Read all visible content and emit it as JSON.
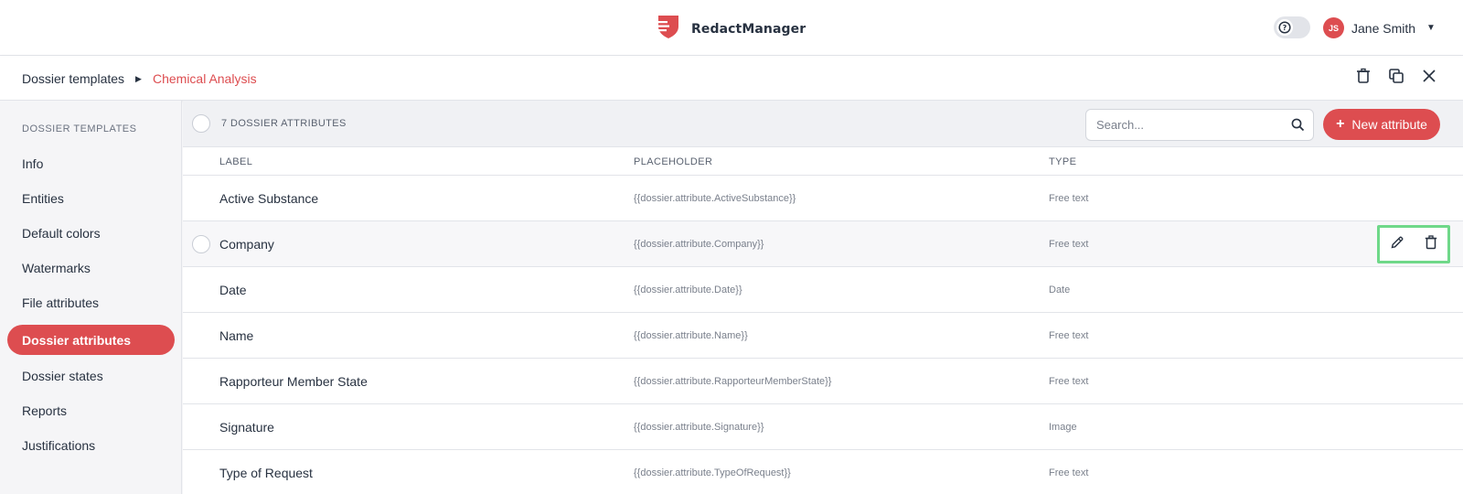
{
  "app": {
    "name": "RedactManager"
  },
  "user": {
    "initials": "JS",
    "name": "Jane Smith"
  },
  "breadcrumb": {
    "root": "Dossier templates",
    "current": "Chemical Analysis"
  },
  "sidebar": {
    "title": "DOSSIER TEMPLATES",
    "items": [
      {
        "label": "Info"
      },
      {
        "label": "Entities"
      },
      {
        "label": "Default colors"
      },
      {
        "label": "Watermarks"
      },
      {
        "label": "File attributes"
      },
      {
        "label": "Dossier attributes",
        "active": true
      },
      {
        "label": "Dossier states"
      },
      {
        "label": "Reports"
      },
      {
        "label": "Justifications"
      }
    ]
  },
  "table": {
    "count_label": "7 DOSSIER ATTRIBUTES",
    "search_placeholder": "Search...",
    "new_button_label": "New attribute",
    "columns": {
      "label": "LABEL",
      "placeholder": "PLACEHOLDER",
      "type": "TYPE"
    },
    "rows": [
      {
        "label": "Active Substance",
        "placeholder": "{{dossier.attribute.ActiveSubstance}}",
        "type": "Free text"
      },
      {
        "label": "Company",
        "placeholder": "{{dossier.attribute.Company}}",
        "type": "Free text"
      },
      {
        "label": "Date",
        "placeholder": "{{dossier.attribute.Date}}",
        "type": "Date"
      },
      {
        "label": "Name",
        "placeholder": "{{dossier.attribute.Name}}",
        "type": "Free text"
      },
      {
        "label": "Rapporteur Member State",
        "placeholder": "{{dossier.attribute.RapporteurMemberState}}",
        "type": "Free text"
      },
      {
        "label": "Signature",
        "placeholder": "{{dossier.attribute.Signature}}",
        "type": "Image"
      },
      {
        "label": "Type of Request",
        "placeholder": "{{dossier.attribute.TypeOfRequest}}",
        "type": "Free text"
      }
    ]
  },
  "icons": {
    "logo": "redact-shield-icon",
    "help": "help-icon",
    "caret": "caret-down-icon",
    "breadcrumb_sep": "caret-right-icon",
    "delete": "trash-icon",
    "clone": "copy-icon",
    "close": "close-icon",
    "search": "search-icon",
    "edit": "pencil-icon"
  },
  "colors": {
    "accent": "#dd4d50",
    "highlight": "#6fd889"
  }
}
